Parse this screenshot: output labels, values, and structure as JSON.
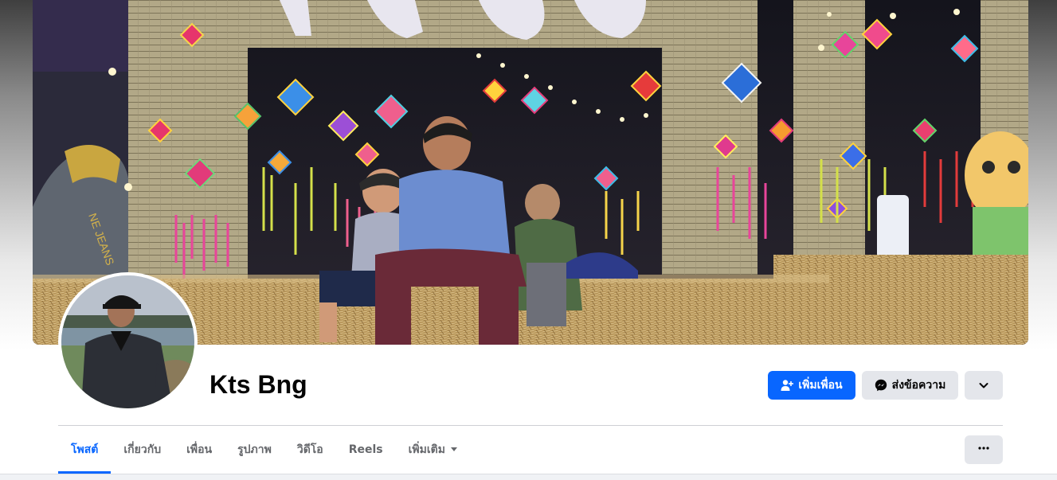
{
  "profile": {
    "name": "Kts Bng"
  },
  "actions": {
    "add_friend_label": "เพิ่มเพื่อน",
    "message_label": "ส่งข้อความ"
  },
  "tabs": [
    {
      "label": "โพสต์",
      "active": true
    },
    {
      "label": "เกี่ยวกับ",
      "active": false
    },
    {
      "label": "เพื่อน",
      "active": false
    },
    {
      "label": "รูปภาพ",
      "active": false
    },
    {
      "label": "วิดีโอ",
      "active": false
    },
    {
      "label": "Reels",
      "active": false
    },
    {
      "label": "เพิ่มเติม",
      "active": false
    }
  ],
  "colors": {
    "accent": "#0866ff",
    "button_gray": "#e4e6eb",
    "text_primary": "#050505",
    "text_secondary": "#65676b"
  },
  "icons": {
    "add_friend": "person-plus-icon",
    "message": "messenger-icon",
    "dropdown": "chevron-down-icon",
    "more": "ellipsis-icon",
    "tab_more": "caret-down-icon"
  }
}
